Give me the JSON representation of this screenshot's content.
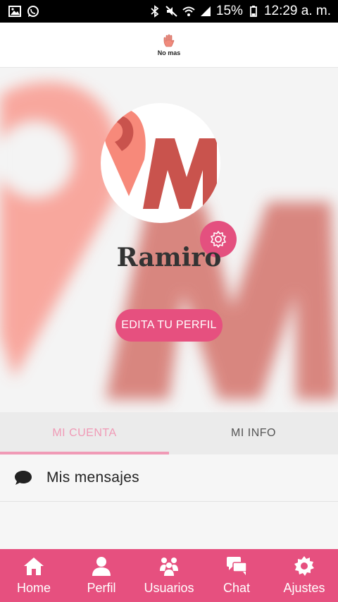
{
  "status_bar": {
    "battery": "15%",
    "time": "12:29 a. m.",
    "left_icons": [
      "image-icon",
      "whatsapp-icon"
    ],
    "right_icons": [
      "bluetooth-icon",
      "mute-icon",
      "wifi-icon",
      "signal-icon",
      "battery-icon"
    ]
  },
  "header": {
    "title": "No mas",
    "icon": "hand-icon"
  },
  "profile": {
    "name": "Ramiro",
    "edit_button": "EDITA TU PERFIL",
    "settings_icon": "gear-icon",
    "accent": "#e6507f"
  },
  "tabs": [
    {
      "label": "MI CUENTA",
      "active": true
    },
    {
      "label": "MI INFO",
      "active": false
    }
  ],
  "menu": [
    {
      "label": "Mis mensajes",
      "icon": "chat-bubble-icon"
    }
  ],
  "bottom_nav": [
    {
      "label": "Home",
      "icon": "home-icon"
    },
    {
      "label": "Perfil",
      "icon": "person-icon"
    },
    {
      "label": "Usuarios",
      "icon": "users-icon"
    },
    {
      "label": "Chat",
      "icon": "chat-icon"
    },
    {
      "label": "Ajustes",
      "icon": "gear-icon"
    }
  ]
}
